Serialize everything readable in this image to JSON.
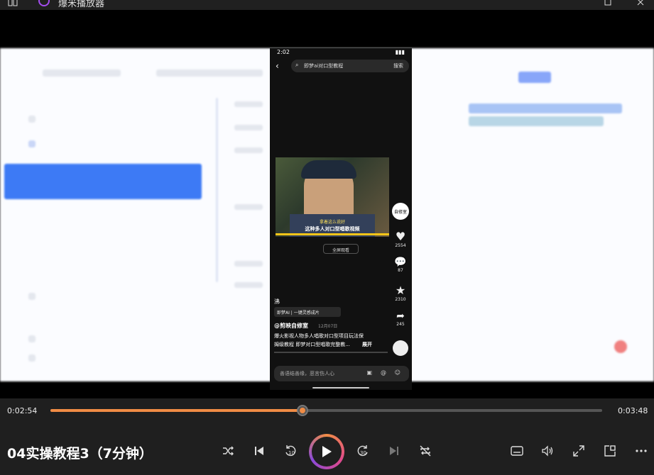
{
  "window": {
    "title": "爆米播放器"
  },
  "phone": {
    "time": "2:02",
    "search_text": "即梦ai对口型教程",
    "search_button": "搜索",
    "caption_top": "拿着这么说好",
    "caption_main": "这种多人对口型唱歌视频",
    "fullscreen_label": "全屏观看",
    "author_avatar": "自修室",
    "likes": "2554",
    "comments": "87",
    "favorites": "2310",
    "shares": "245",
    "watermark": "沸",
    "tag_text": "即梦AI | 一键灵感成片",
    "author": "@剪映自修室",
    "date": "12月07日",
    "desc_line1": "爆火影视人物多人唱歌对口型项目玩法保",
    "desc_line2": "姆级教程 即梦对口型唱歌完整教...",
    "expand": "展开",
    "comment_placeholder": "善语结善缘，恶言伤人心"
  },
  "player": {
    "current_time": "0:02:54",
    "total_time": "0:03:48",
    "progress": 0.4567,
    "video_title": "04实操教程3（7分钟）",
    "accent": "#f08c45"
  },
  "icons": {
    "shuffle": "shuffle-icon",
    "previous": "skip-previous-icon",
    "rewind": "rewind-10-icon",
    "play": "play-icon",
    "forward": "forward-30-icon",
    "next": "skip-next-icon",
    "repeat_off": "repeat-off-icon",
    "subtitles": "subtitles-icon",
    "volume": "volume-icon",
    "fullscreen": "fullscreen-icon",
    "miniplayer": "miniplayer-icon",
    "more": "more-icon"
  }
}
